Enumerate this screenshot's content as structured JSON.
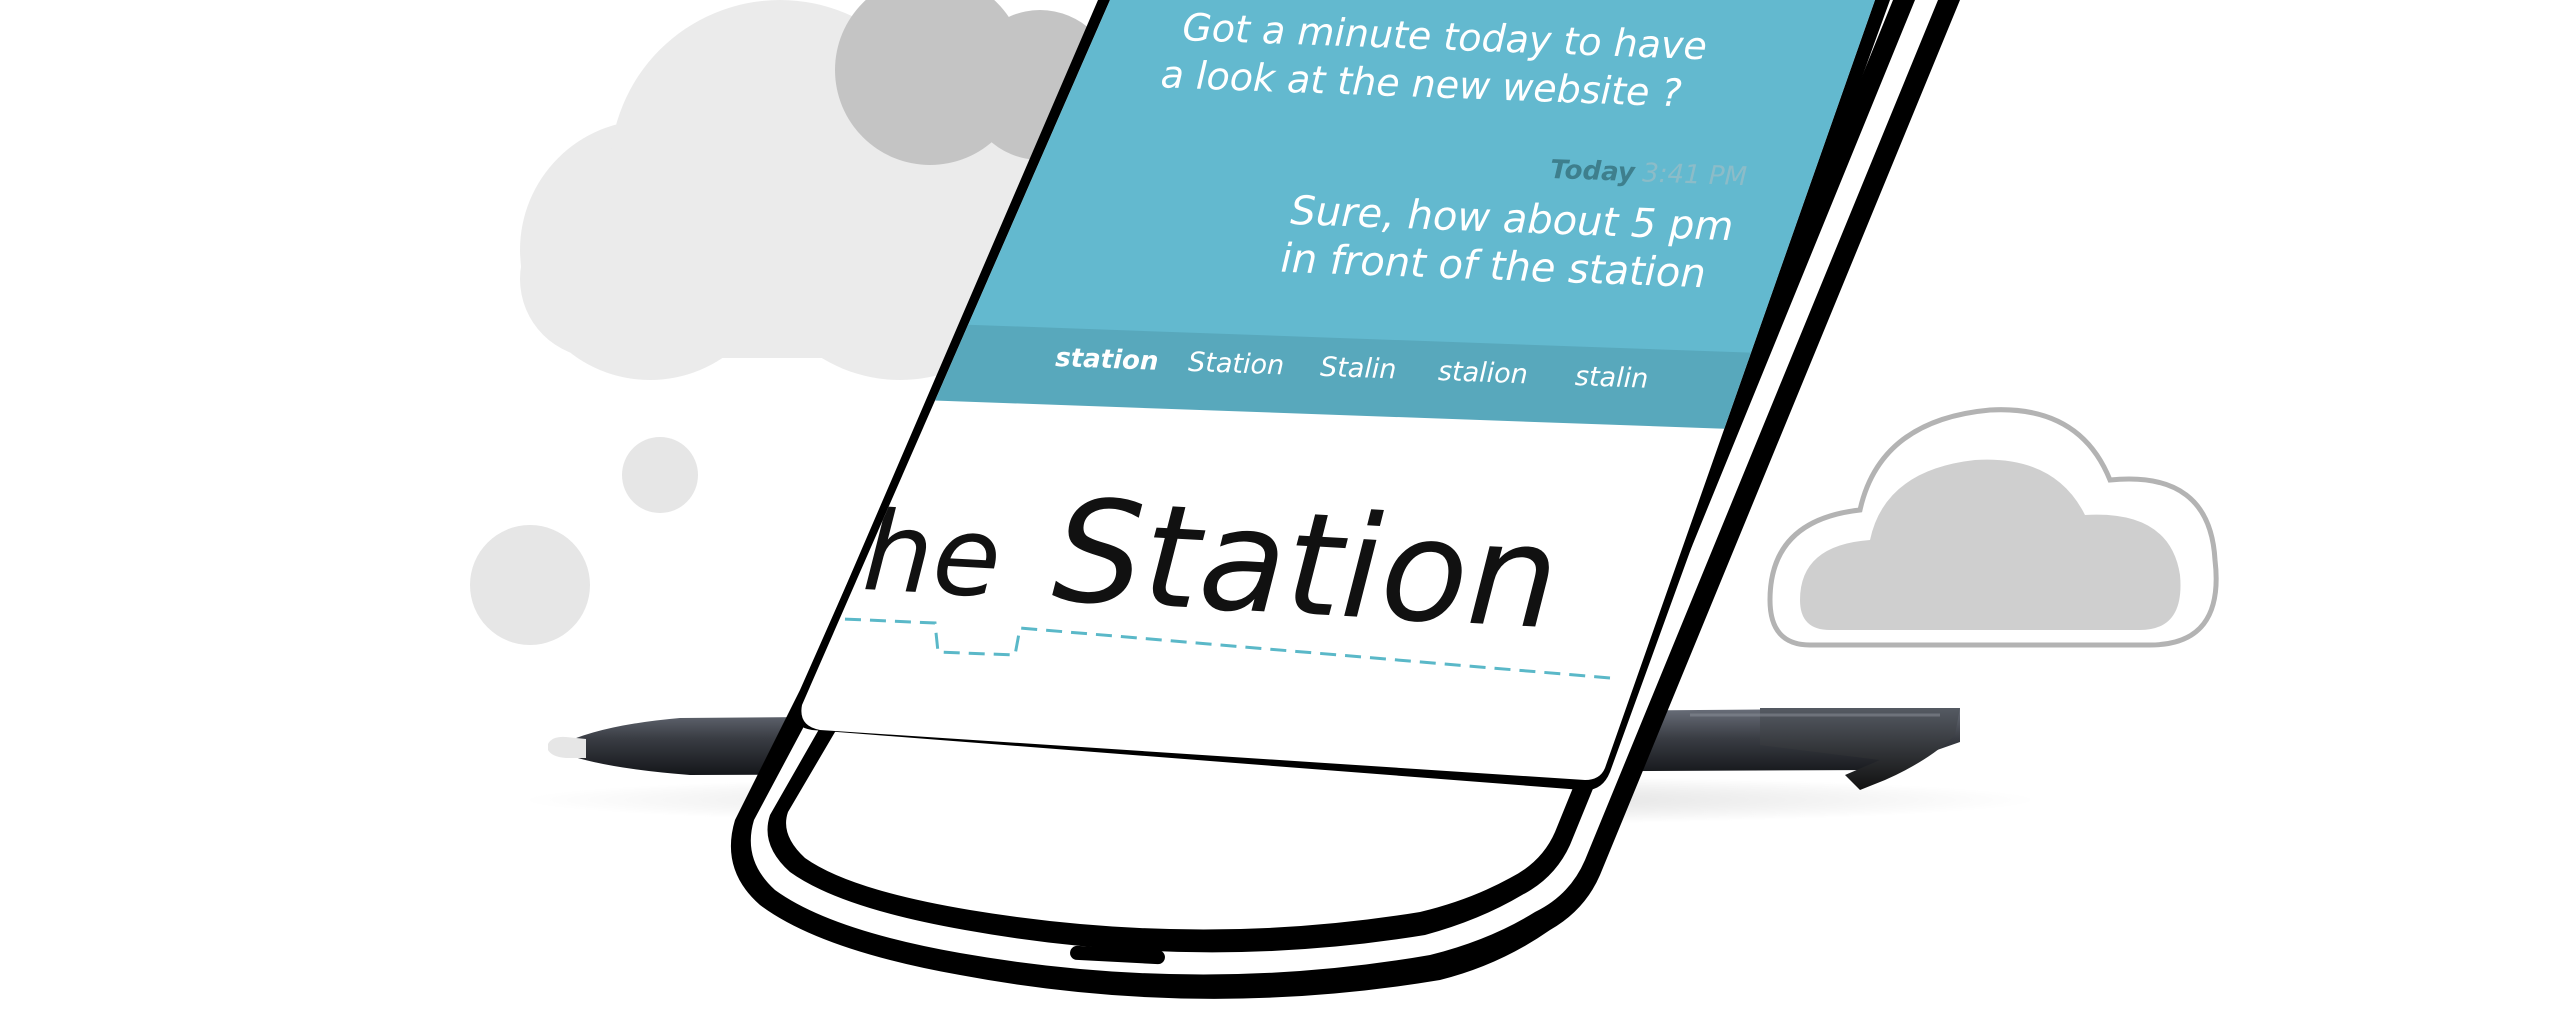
{
  "conversation": {
    "incoming_message": {
      "lines": [
        "Got a minute today to have",
        "a look at the new website ?"
      ]
    },
    "reply": {
      "day_label": "Today",
      "time_label": "3:41 PM",
      "lines": [
        "Sure, how about 5 pm",
        "in front of the station"
      ]
    }
  },
  "suggestions": {
    "items": [
      "station",
      "Station",
      "Stalin",
      "stalion",
      "stalin"
    ],
    "selected": "station"
  },
  "handwriting": {
    "partial_prefix": "he",
    "word": "Station"
  },
  "colors": {
    "chat_background": "#63b9cf",
    "suggestion_bar": "#58a8bc",
    "baseline_guide": "#5ab8c8",
    "cloud_light": "#efefef",
    "cloud_mid": "#cfcfcf",
    "cloud_dark": "#c4c4c4"
  },
  "icons": {
    "phone": "phone-outline-illustration",
    "stylus": "stylus-pen",
    "clouds": "cloud-icon"
  }
}
